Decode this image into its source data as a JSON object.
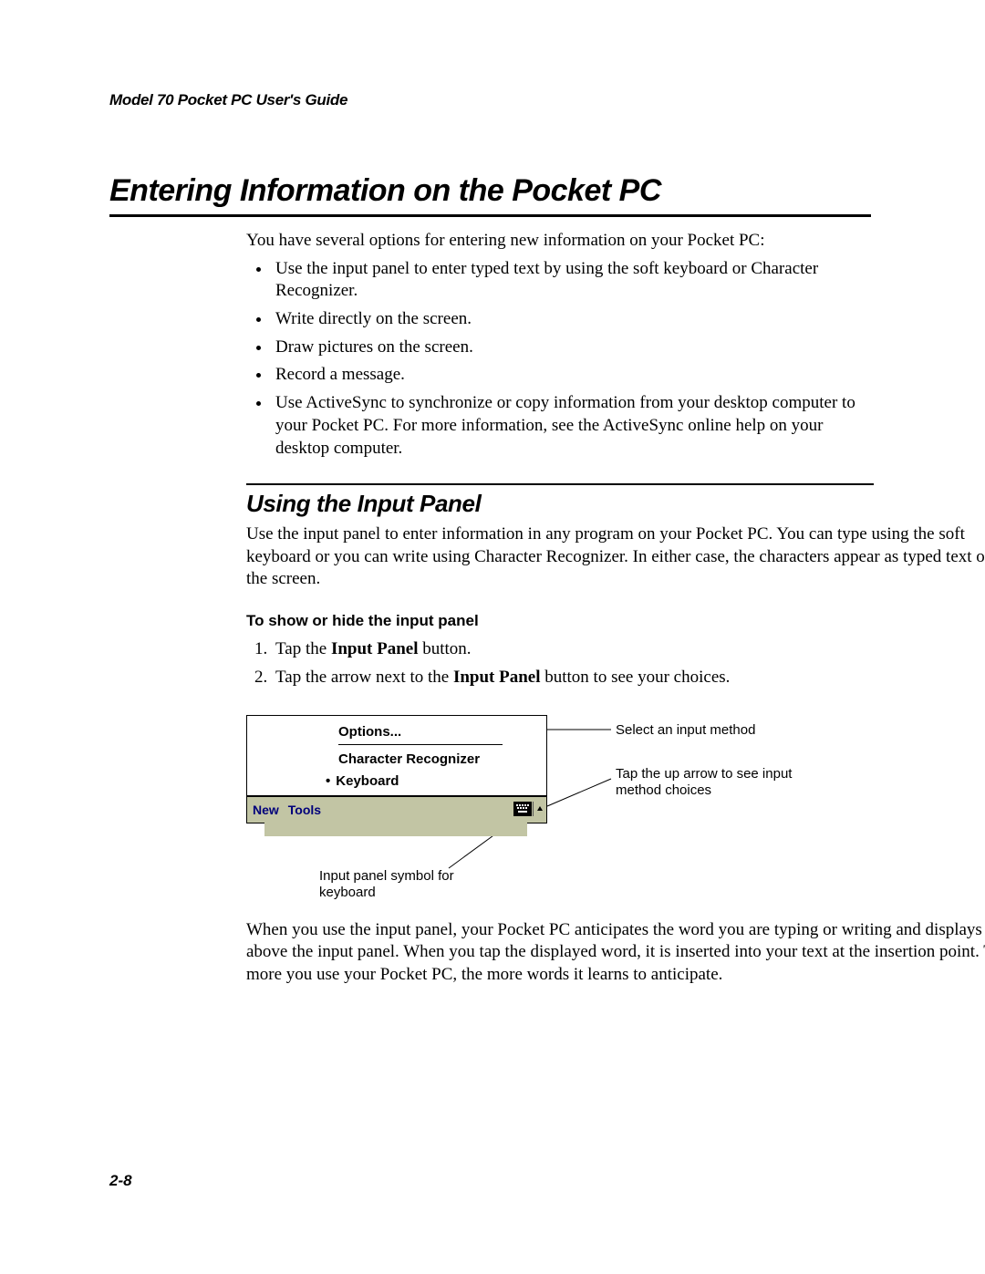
{
  "header": {
    "title": "Model 70 Pocket PC User's Guide"
  },
  "section": {
    "h1": "Entering Information on the Pocket PC",
    "intro": "You have several options for entering new information on your Pocket PC:",
    "bullets": [
      "Use the input panel to enter typed text by using the soft keyboard or Character Recognizer.",
      "Write directly on the screen.",
      "Draw pictures on the screen.",
      "Record a message.",
      "Use ActiveSync to synchronize or copy information from your desktop computer to your Pocket PC. For more information, see the ActiveSync online help on your desktop computer."
    ]
  },
  "subsection": {
    "h2": "Using the Input Panel",
    "para": "Use the input panel to enter information in any program on your Pocket PC. You can type using the soft keyboard or you can write using Character Recognizer. In either case, the characters appear as typed text on the screen.",
    "h3": "To show or hide the input panel",
    "steps": {
      "s1_a": "Tap the ",
      "s1_b": "Input Panel",
      "s1_c": " button.",
      "s2_a": "Tap the arrow next to the ",
      "s2_b": "Input Panel",
      "s2_c": " button to see your choices."
    }
  },
  "figure": {
    "menu": {
      "options": "Options...",
      "char_rec": "Character Recognizer",
      "keyboard": "Keyboard",
      "bullet": "•"
    },
    "bar": {
      "new": "New",
      "tools": "Tools"
    },
    "callouts": {
      "c1": "Select an input method",
      "c2": "Tap the up arrow to see input method choices",
      "c3": "Input panel symbol for keyboard"
    }
  },
  "closing": {
    "para": "When you use the input panel, your Pocket PC anticipates the word you are typing or writing and displays it above the input panel. When you tap the displayed word, it is inserted into your text at the insertion point. The more you use your Pocket PC, the more words it learns to anticipate."
  },
  "footer": {
    "pagenum": "2-8"
  }
}
